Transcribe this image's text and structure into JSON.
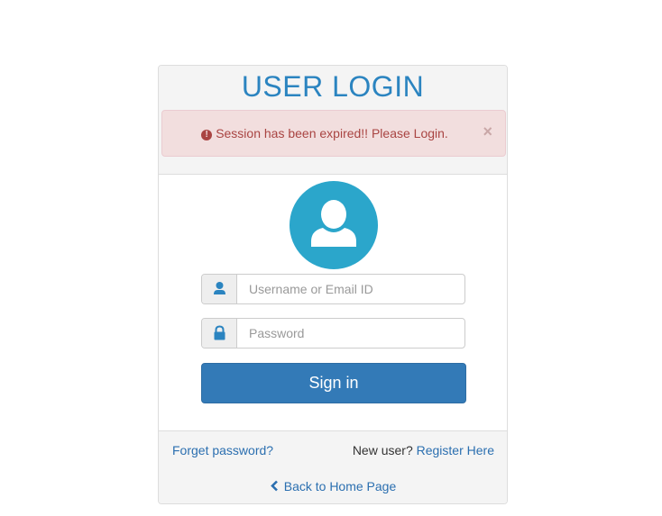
{
  "login": {
    "title": "USER LOGIN",
    "alert": {
      "icon": "exclamation-circle-icon",
      "message": "Session has been expired!! Please Login.",
      "close_glyph": "×"
    },
    "avatar_icon": "user-avatar-icon",
    "username": {
      "placeholder": "Username or Email ID",
      "value": "",
      "icon": "user-icon"
    },
    "password": {
      "placeholder": "Password",
      "value": "",
      "icon": "lock-icon"
    },
    "signin_label": "Sign in",
    "forgot_label": "Forget password?",
    "new_user_text": "New user?",
    "register_label": "Register Here",
    "back_label": "Back to Home Page"
  },
  "colors": {
    "title": "#2b84c0",
    "alert_bg": "#f2dede",
    "alert_text": "#a94442",
    "avatar_bg": "#2ba6cb",
    "button_bg": "#337ab7",
    "link": "#2b6fb0"
  }
}
